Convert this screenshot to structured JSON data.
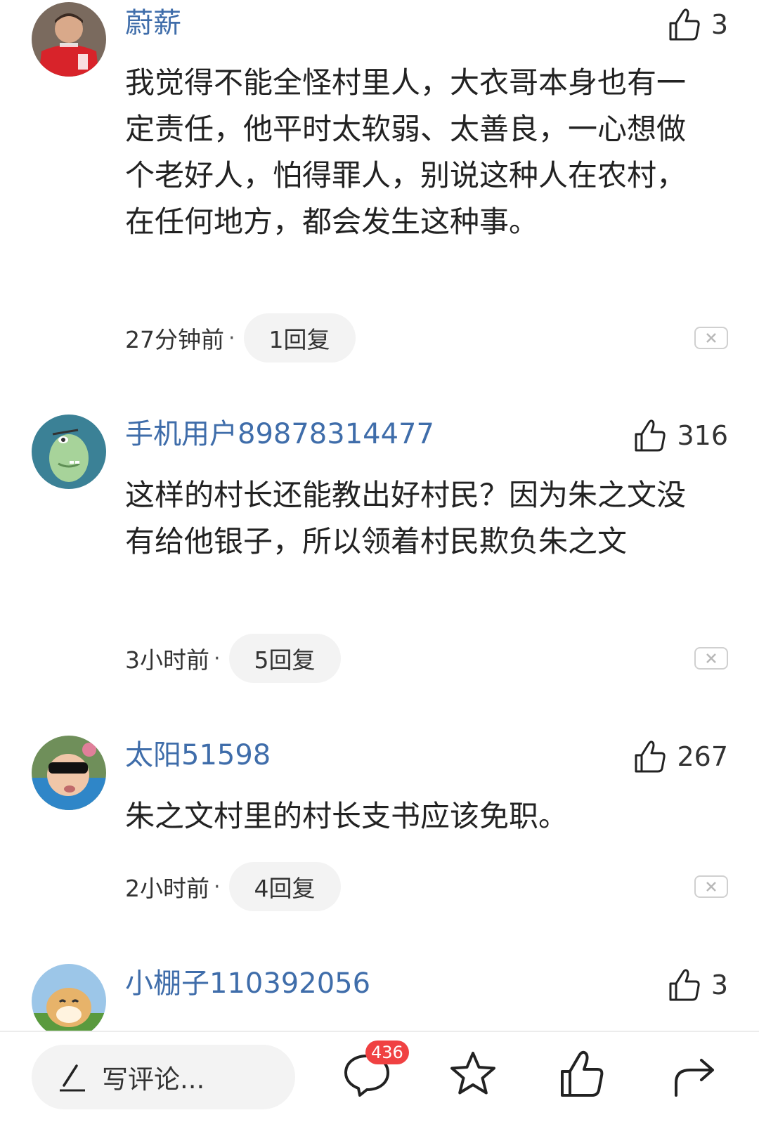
{
  "comments": [
    {
      "username": "蔚薪",
      "likes": "3",
      "text": "我觉得不能全怪村里人，大衣哥本身也有一定责任，他平时太软弱、太善良，一心想做个老好人，怕得罪人，别说这种人在农村，在任何地方，都会发生这种事。",
      "time": "27分钟前",
      "separator": "·",
      "replies": "1回复"
    },
    {
      "username": "手机用户89878314477",
      "likes": "316",
      "text": "这样的村长还能教出好村民？因为朱之文没有给他银子，所以领着村民欺负朱之文",
      "time": "3小时前",
      "separator": "·",
      "replies": "5回复"
    },
    {
      "username": "太阳51598",
      "likes": "267",
      "text": "朱之文村里的村长支书应该免职。",
      "time": "2小时前",
      "separator": "·",
      "replies": "4回复"
    },
    {
      "username": "小棚子110392056",
      "likes": "3"
    }
  ],
  "bottom_bar": {
    "input_placeholder": "写评论...",
    "comment_count": "436"
  },
  "colors": {
    "username": "#3f6daa",
    "badge": "#f04142",
    "pill_bg": "#f3f3f3"
  }
}
